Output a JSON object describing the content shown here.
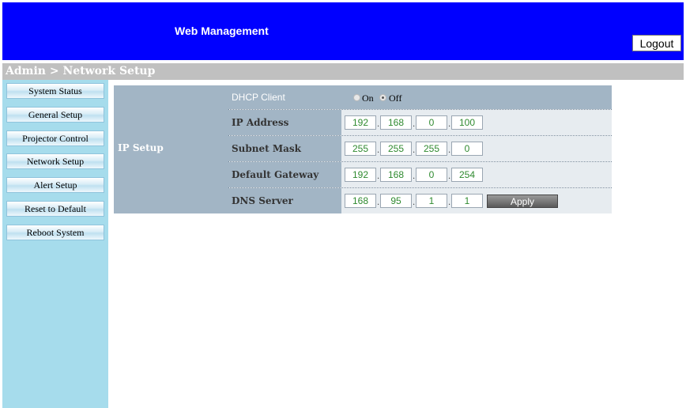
{
  "header": {
    "title": "Web Management",
    "logout_label": "Logout",
    "color": "#0000ff"
  },
  "breadcrumb": "Admin > Network Setup",
  "sidebar": {
    "items": [
      {
        "label": "System Status"
      },
      {
        "label": "General Setup"
      },
      {
        "label": "Projector Control"
      },
      {
        "label": "Network Setup"
      },
      {
        "label": "Alert Setup"
      },
      {
        "label": "Reset to Default"
      },
      {
        "label": "Reboot System"
      }
    ]
  },
  "ip_setup": {
    "section_label": "IP Setup",
    "dhcp": {
      "label": "DHCP Client",
      "on_label": "On",
      "off_label": "Off",
      "selected": "Off"
    },
    "ip_address": {
      "label": "IP Address",
      "octets": [
        "192",
        "168",
        "0",
        "100"
      ]
    },
    "subnet_mask": {
      "label": "Subnet Mask",
      "octets": [
        "255",
        "255",
        "255",
        "0"
      ]
    },
    "default_gateway": {
      "label": "Default Gateway",
      "octets": [
        "192",
        "168",
        "0",
        "254"
      ]
    },
    "dns_server": {
      "label": "DNS Server",
      "octets": [
        "168",
        "95",
        "1",
        "1"
      ]
    },
    "apply_label": "Apply"
  }
}
